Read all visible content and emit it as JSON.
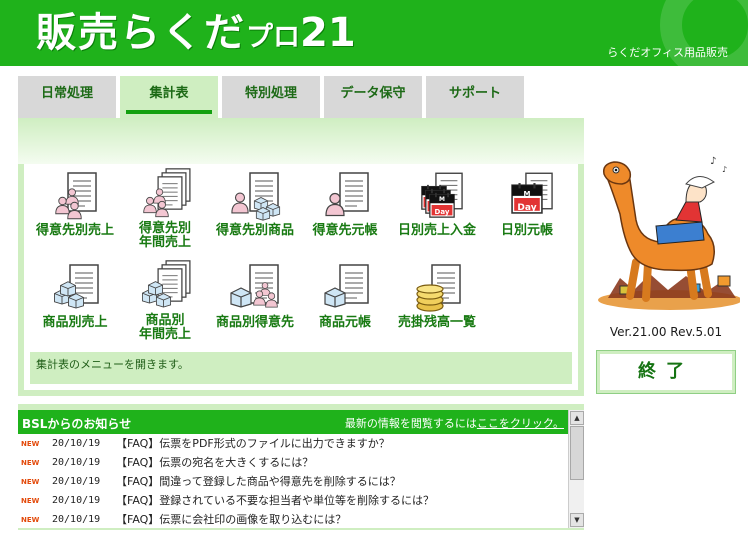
{
  "header": {
    "logo_main": "販売らくだ",
    "logo_sub": "プロ",
    "logo_num": "21",
    "company": "らくだオフィス用品販売"
  },
  "tabs": [
    {
      "label": "日常処理",
      "active": false
    },
    {
      "label": "集計表",
      "active": true
    },
    {
      "label": "特別処理",
      "active": false
    },
    {
      "label": "データ保守",
      "active": false
    },
    {
      "label": "サポート",
      "active": false
    }
  ],
  "menu": {
    "row1": [
      {
        "label": "得意先別売上",
        "icon": "people-report-icon"
      },
      {
        "label": "得意先別\n年間売上",
        "icon": "people-multi-report-icon"
      },
      {
        "label": "得意先別商品",
        "icon": "people-boxes-report-icon"
      },
      {
        "label": "得意先元帳",
        "icon": "person-ledger-icon"
      },
      {
        "label": "日別売上入金",
        "icon": "calendar-day-report-icon",
        "day_text": "Day",
        "month_text": "M"
      },
      {
        "label": "日別元帳",
        "icon": "calendar-day-icon",
        "day_text": "Day",
        "month_text": "M"
      }
    ],
    "row2": [
      {
        "label": "商品別売上",
        "icon": "boxes-report-icon"
      },
      {
        "label": "商品別\n年間売上",
        "icon": "boxes-multi-report-icon"
      },
      {
        "label": "商品別得意先",
        "icon": "box-people-report-icon"
      },
      {
        "label": "商品元帳",
        "icon": "box-ledger-icon"
      },
      {
        "label": "売掛残高一覧",
        "icon": "coins-report-icon"
      }
    ]
  },
  "status_text": "集計表のメニューを開きます。",
  "version": "Ver.21.00 Rev.5.01",
  "end_button": "終了",
  "news": {
    "title": "BSLからのお知らせ",
    "prompt": "最新の情報を閲覧するには",
    "link": "ここをクリック。",
    "badge": "NEW",
    "items": [
      {
        "date": "20/10/19",
        "title": "【FAQ】伝票をPDF形式のファイルに出力できますか？"
      },
      {
        "date": "20/10/19",
        "title": "【FAQ】伝票の宛名を大きくするには？"
      },
      {
        "date": "20/10/19",
        "title": "【FAQ】間違って登録した商品や得意先を削除するには？"
      },
      {
        "date": "20/10/19",
        "title": "【FAQ】登録されている不要な担当者や単位等を削除するには？"
      },
      {
        "date": "20/10/19",
        "title": "【FAQ】伝票に会社印の画像を取り込むには？"
      }
    ]
  },
  "colors": {
    "brand_green": "#1fb21b",
    "panel_green": "#cfeec1",
    "label_green": "#187a12",
    "new_badge": "#e34a0b"
  }
}
